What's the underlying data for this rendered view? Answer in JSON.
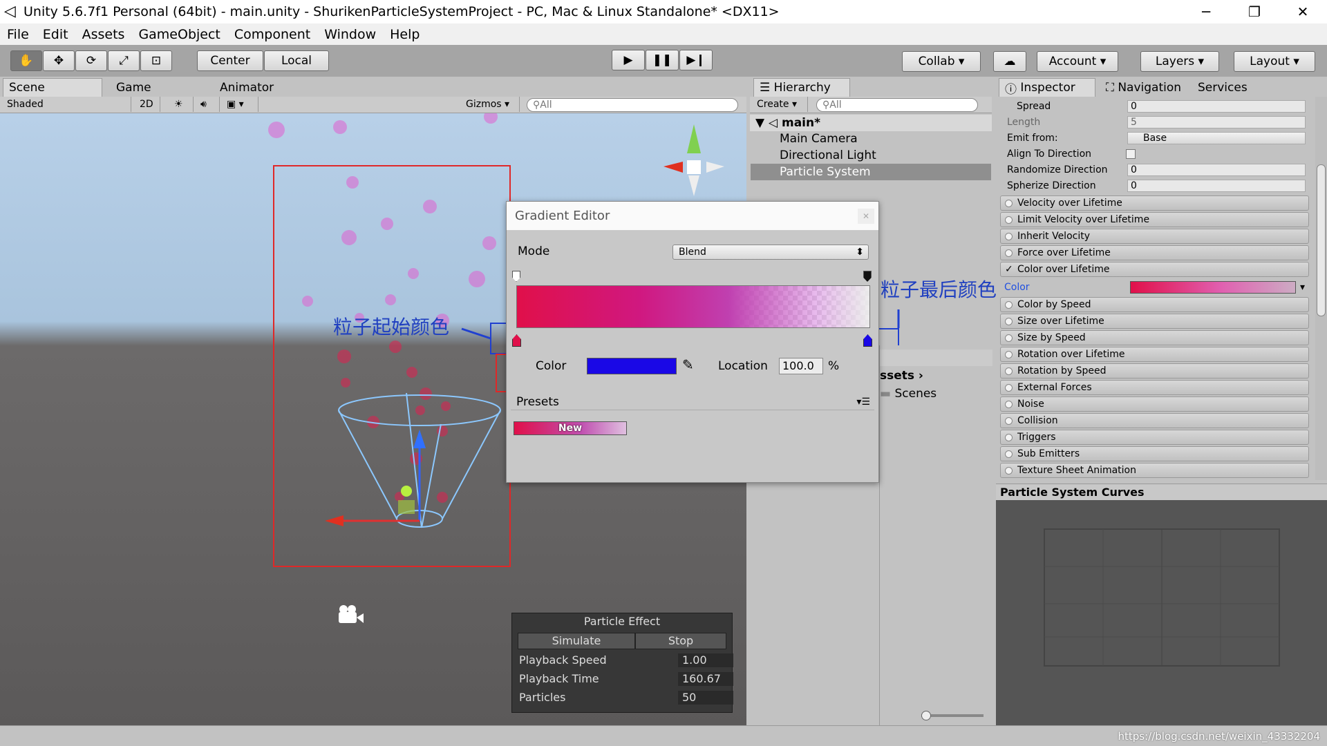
{
  "window": {
    "title": "Unity 5.6.7f1 Personal (64bit) - main.unity - ShurikenParticleSystemProject - PC, Mac & Linux Standalone* <DX11>",
    "minimize": "─",
    "maximize": "❐",
    "close": "✕"
  },
  "menu": [
    "File",
    "Edit",
    "Assets",
    "GameObject",
    "Component",
    "Window",
    "Help"
  ],
  "toolbar": {
    "center": "Center",
    "local": "Local",
    "collab": "Collab ▾",
    "account": "Account ▾",
    "layers": "Layers ▾",
    "layout": "Layout ▾"
  },
  "scene_panel": {
    "tabs": [
      "Scene",
      "Game",
      "Animator"
    ],
    "shaded": "Shaded",
    "mode_2d": "2D",
    "gizmos": "Gizmos ▾",
    "search_placeholder": "All"
  },
  "hierarchy": {
    "tab": "Hierarchy",
    "create": "Create ▾",
    "search_placeholder": "All",
    "scene": "main*",
    "items": [
      "Main Camera",
      "Directional Light",
      "Particle System"
    ],
    "selected": 2
  },
  "project": {
    "assets": "ssets ›",
    "folder": "Scenes"
  },
  "inspector": {
    "tabs": [
      "Inspector",
      "Navigation",
      "Services"
    ],
    "rows": [
      {
        "label": "Spread",
        "value": "0"
      },
      {
        "label": "Length",
        "value": "5"
      },
      {
        "label": "Emit from:",
        "value": "Base"
      },
      {
        "label": "Align To Direction",
        "value": ""
      },
      {
        "label": "Randomize Direction",
        "value": "0"
      },
      {
        "label": "Spherize Direction",
        "value": "0"
      }
    ],
    "modules": [
      "Velocity over Lifetime",
      "Limit Velocity over Lifetime",
      "Inherit Velocity",
      "Force over Lifetime",
      "Color over Lifetime"
    ],
    "color_label": "Color",
    "modules2": [
      "Color by Speed",
      "Size over Lifetime",
      "Size by Speed",
      "Rotation over Lifetime",
      "Rotation by Speed",
      "External Forces",
      "Noise",
      "Collision",
      "Triggers",
      "Sub Emitters",
      "Texture Sheet Animation"
    ],
    "curves_title": "Particle System Curves"
  },
  "gradient_editor": {
    "title": "Gradient Editor",
    "mode_label": "Mode",
    "mode_value": "Blend",
    "color_label": "Color",
    "location_label": "Location",
    "location_value": "100.0",
    "percent": "%",
    "presets_label": "Presets",
    "preset_new": "New",
    "start_color": "#e0104a",
    "end_color": "#1a08e6"
  },
  "particle_effect": {
    "title": "Particle Effect",
    "simulate": "Simulate",
    "stop": "Stop",
    "rows": [
      {
        "label": "Playback Speed",
        "value": "1.00"
      },
      {
        "label": "Playback Time",
        "value": "160.67"
      },
      {
        "label": "Particles",
        "value": "50"
      }
    ]
  },
  "annotations": {
    "start": "粒子起始颜色",
    "end": "粒子最后颜色"
  },
  "watermark": "https://blog.csdn.net/weixin_43332204"
}
